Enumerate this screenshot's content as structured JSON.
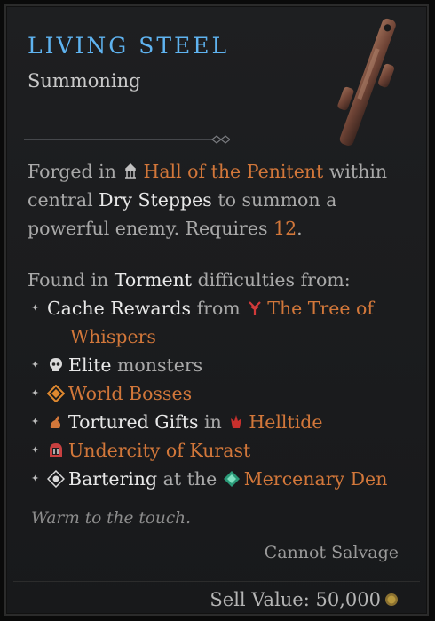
{
  "item": {
    "name": "LIVING STEEL",
    "type": "Summoning"
  },
  "description": {
    "forged_in": "Forged in",
    "location": "Hall of the Penitent",
    "within": "within",
    "central": "central",
    "region": "Dry Steppes",
    "to_summon": "to summon a",
    "powerful": "powerful enemy. Requires",
    "level": "12",
    "period": "."
  },
  "sources": {
    "heading_found": "Found in",
    "heading_difficulty": "Torment",
    "heading_rest": "difficulties from:",
    "items": [
      {
        "pre": "Cache Rewards",
        "mid": "from",
        "link": "The Tree of",
        "link2": "Whispers",
        "icon": "tree-of-whispers-icon"
      },
      {
        "pre": "Elite",
        "mid": "monsters",
        "icon": "skull-icon"
      },
      {
        "link": "World Bosses",
        "icon": "world-boss-icon"
      },
      {
        "pre": "Tortured Gifts",
        "mid": "in",
        "link": "Helltide",
        "icon": "helltide-icon"
      },
      {
        "link": "Undercity of Kurast",
        "icon": "undercity-icon"
      },
      {
        "pre": "Bartering",
        "mid": "at the",
        "link": "Mercenary Den",
        "icon": "mercenary-den-icon"
      }
    ]
  },
  "flavor": "Warm to the touch.",
  "salvage": "Cannot Salvage",
  "sell": {
    "label": "Sell Value:",
    "value": "50,000"
  }
}
